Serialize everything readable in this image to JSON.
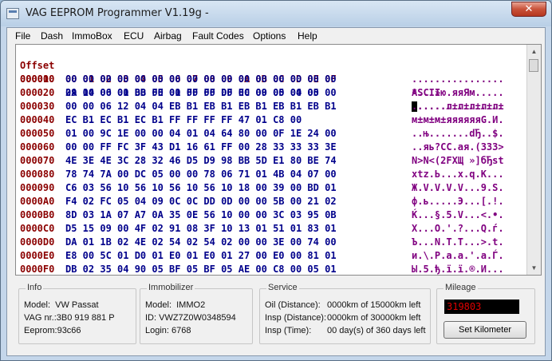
{
  "window": {
    "title": "VAG EEPROM Programmer  V1.19g -",
    "close_glyph": "✕"
  },
  "menu": [
    "File",
    "Dash",
    "ImmoBox",
    "ECU",
    "Airbag",
    "Fault Codes",
    "Options",
    "Help"
  ],
  "hex_header": {
    "offset": "Offset",
    "hex": "00 01 02 03 04 05 06 07 08 09 0A 0B 0C 0D 0E 0F",
    "ascii": "ASCII"
  },
  "hex_rows": [
    {
      "offset": "000000",
      "hex": "09 00 00 00 00 00 00 00 00 00 00 00 00 00 00 00",
      "ascii": "..............."
    },
    {
      "offset": "000010",
      "hex": "00 00 00 00 00 00 00 00 00 00 00 00 00 00 00 00",
      "ascii": "................"
    },
    {
      "offset": "000020",
      "hex": "2A 14 06 01 BB FE 01 FF FF DF EC 09 05 04 05",
      "ascii": "*...»ю.яяЯм....."
    },
    {
      "offset": "000030",
      "hex": "00 00 06 12 04 04 EB B1 EB B1 EB B1 EB B1 EB B1",
      "ascii": "......л±л±л±л±л±"
    },
    {
      "offset": "000040",
      "hex": "EC B1 EC B1 EC B1 FF FF FF FF 47 01 C8 00",
      "ascii": "м±м±м±яяяяяяG.И."
    },
    {
      "offset": "000050",
      "hex": "01 00 9C 1E 00 00 04 01 04 64 80 00 0F 1E 24 00",
      "ascii": "..њ.......dЂ..$."
    },
    {
      "offset": "000060",
      "hex": "00 00 FF FC 3F 43 D1 16 61 FF 00 28 33 33 33 3E",
      "ascii": "..яь?CС.aя.(333>"
    },
    {
      "offset": "000070",
      "hex": "4E 3E 4E 3C 28 32 46 D5 D9 98 BB 5D E1 80 BE 74",
      "ascii": "N>N<(2FХЩ »]бЂѕt"
    },
    {
      "offset": "000080",
      "hex": "78 74 7A 00 DC 05 00 00 78 06 71 01 4B 04 07 00",
      "ascii": "xtz.Ь...x.q.K..."
    },
    {
      "offset": "000090",
      "hex": "C6 03 56 10 56 10 56 10 56 10 18 00 39 00 BD 01",
      "ascii": "Ж.V.V.V.V...9.Ѕ."
    },
    {
      "offset": "0000A0",
      "hex": "F4 02 FC 05 04 09 0C 0C DD 0D 00 00 5B 00 21 02",
      "ascii": "ф.ь.....Э...[.!."
    },
    {
      "offset": "0000B0",
      "hex": "8D 03 1A 07 A7 0A 35 0E 56 10 00 00 3C 03 95 0B",
      "ascii": "Ќ...§.5.V...<.•."
    },
    {
      "offset": "0000C0",
      "hex": "D5 15 09 00 4F 02 91 08 3F 10 13 01 51 01 83 01",
      "ascii": "Х...O.'.?...Q.ѓ."
    },
    {
      "offset": "0000D0",
      "hex": "DA 01 1B 02 4E 02 54 02 54 02 00 00 3E 00 74 00",
      "ascii": "Ъ...N.T.T...>.t."
    },
    {
      "offset": "0000E0",
      "hex": "E8 00 5C 01 D0 01 E0 01 E0 01 27 00 E0 00 81 01",
      "ascii": "и.\\.Р.а.а.'.а.Ѓ."
    },
    {
      "offset": "0000F0",
      "hex": "DB 02 35 04 90 05 BF 05 BF 05 AE 00 C8 00 05 01",
      "ascii": "Ы.5.ђ.ї.ї.®.И..."
    }
  ],
  "info": {
    "title": "Info",
    "model": "Model:  VW Passat",
    "vag_nr": "VAG nr.:3B0 919 881 P",
    "eeprom": "Eeprom:93c66"
  },
  "immobilizer": {
    "title": "Immobilizer",
    "model": "Model:  IMMO2",
    "id": "ID: VWZ7Z0W0348594",
    "login": "Login: 6768"
  },
  "service": {
    "title": "Service",
    "rows": [
      {
        "label": "Oil (Distance):",
        "value": "0000km of 15000km left"
      },
      {
        "label": "Insp (Distance):",
        "value": "0000km of 30000km left"
      },
      {
        "label": "Insp (Time):",
        "value": "00 day(s) of 360 days left"
      }
    ]
  },
  "mileage": {
    "title": "Mileage",
    "value": "319803",
    "button": "Set Kilometer"
  }
}
